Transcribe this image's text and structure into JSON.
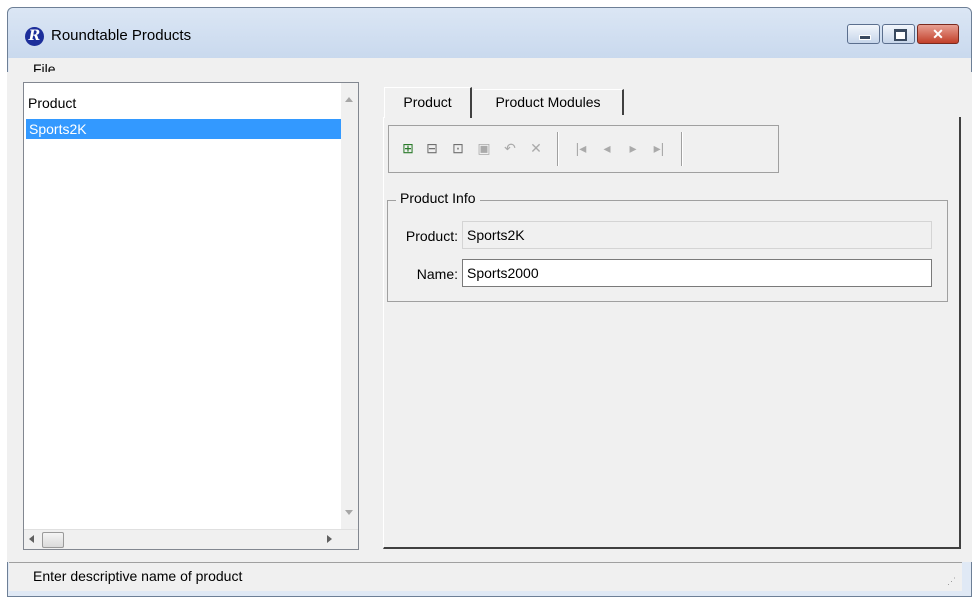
{
  "window": {
    "title": "Roundtable Products",
    "app_icon": "R"
  },
  "menu": {
    "file": "File"
  },
  "list": {
    "header": "Product",
    "rows": [
      "Sports2K"
    ]
  },
  "tabs": [
    "Product",
    "Product Modules"
  ],
  "toolbar": {
    "buttons": [
      "add-record-icon",
      "copy-record-icon",
      "edit-record-icon",
      "save-record-icon",
      "undo-icon",
      "delete-icon",
      "first-record-icon",
      "prev-record-icon",
      "next-record-icon",
      "last-record-icon"
    ],
    "glyphs": [
      "⊞",
      "⊟",
      "⊡",
      "▣",
      "↶",
      "✕",
      "|◂",
      "◂",
      "▸",
      "▸|"
    ]
  },
  "form": {
    "group_title": "Product Info",
    "product_label": "Product:",
    "product_value": "Sports2K",
    "name_label": "Name:",
    "name_value": "Sports2000"
  },
  "status": {
    "text": "Enter descriptive name of product"
  },
  "colors": {
    "selection": "#3399ff",
    "title_gradient": "#c9d9ee",
    "close_button": "#c2402a"
  }
}
